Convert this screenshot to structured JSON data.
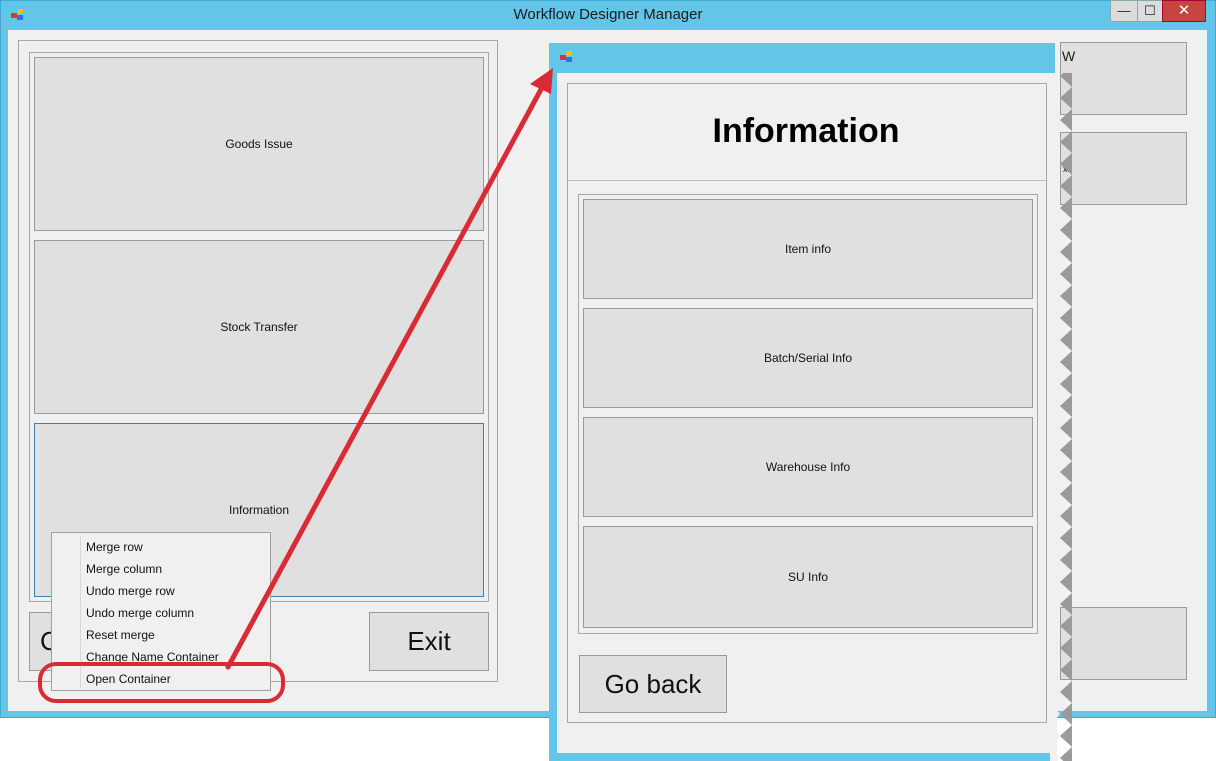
{
  "main_window": {
    "title": "Workflow Designer Manager",
    "controls": {
      "minimize": "—",
      "maximize": "☐",
      "close": "✕"
    },
    "icon": "app-icon",
    "containers": [
      {
        "label": "Goods Issue"
      },
      {
        "label": "Stock Transfer"
      },
      {
        "label": "Information"
      }
    ],
    "left_button_partial": "C",
    "exit_label": "Exit"
  },
  "context_menu": {
    "items": [
      "Merge row",
      "Merge column",
      "Undo merge row",
      "Undo merge column",
      "Reset merge",
      "Change Name Container",
      "Open Container"
    ],
    "highlighted_item": "Open Container"
  },
  "popup_window": {
    "icon": "app-icon",
    "partial_title": "W",
    "header": "Information",
    "items": [
      "Item info",
      "Batch/Serial Info",
      "Warehouse Info",
      "SU Info"
    ],
    "go_back_label": "Go back",
    "partial_right_label": "xit"
  },
  "annotation": {
    "color": "#d92a35"
  }
}
